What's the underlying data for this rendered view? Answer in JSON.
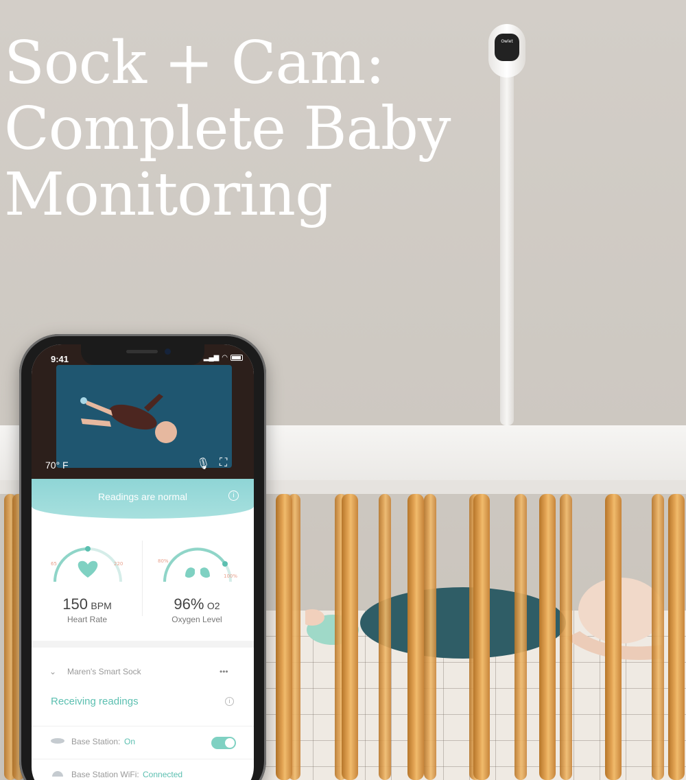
{
  "headline": {
    "line1": "Sock  + Cam:",
    "line2": "Complete Baby",
    "line3": "Monitoring"
  },
  "camera": {
    "logo": "Owlet"
  },
  "phone": {
    "status_time": "9:41",
    "video": {
      "temperature": "70° F"
    },
    "banner": {
      "text": "Readings are normal"
    },
    "heart": {
      "value": "150",
      "unit": "BPM",
      "label": "Heart Rate",
      "min": "65",
      "max": "220"
    },
    "oxygen": {
      "value": "96%",
      "unit": "O2",
      "label": "Oxygen Level",
      "min": "80%",
      "max": "100%"
    },
    "sock": {
      "title": "Maren's Smart Sock",
      "menu": "•••",
      "receiving": "Receiving readings"
    },
    "base_station": {
      "label": "Base Station:",
      "value": "On",
      "toggle_on": true
    },
    "base_wifi": {
      "label": "Base Station WiFi:",
      "value": "Connected"
    }
  },
  "colors": {
    "accent": "#5bbfb0",
    "banner": "#9edbd9",
    "slat": "#e3a454"
  }
}
